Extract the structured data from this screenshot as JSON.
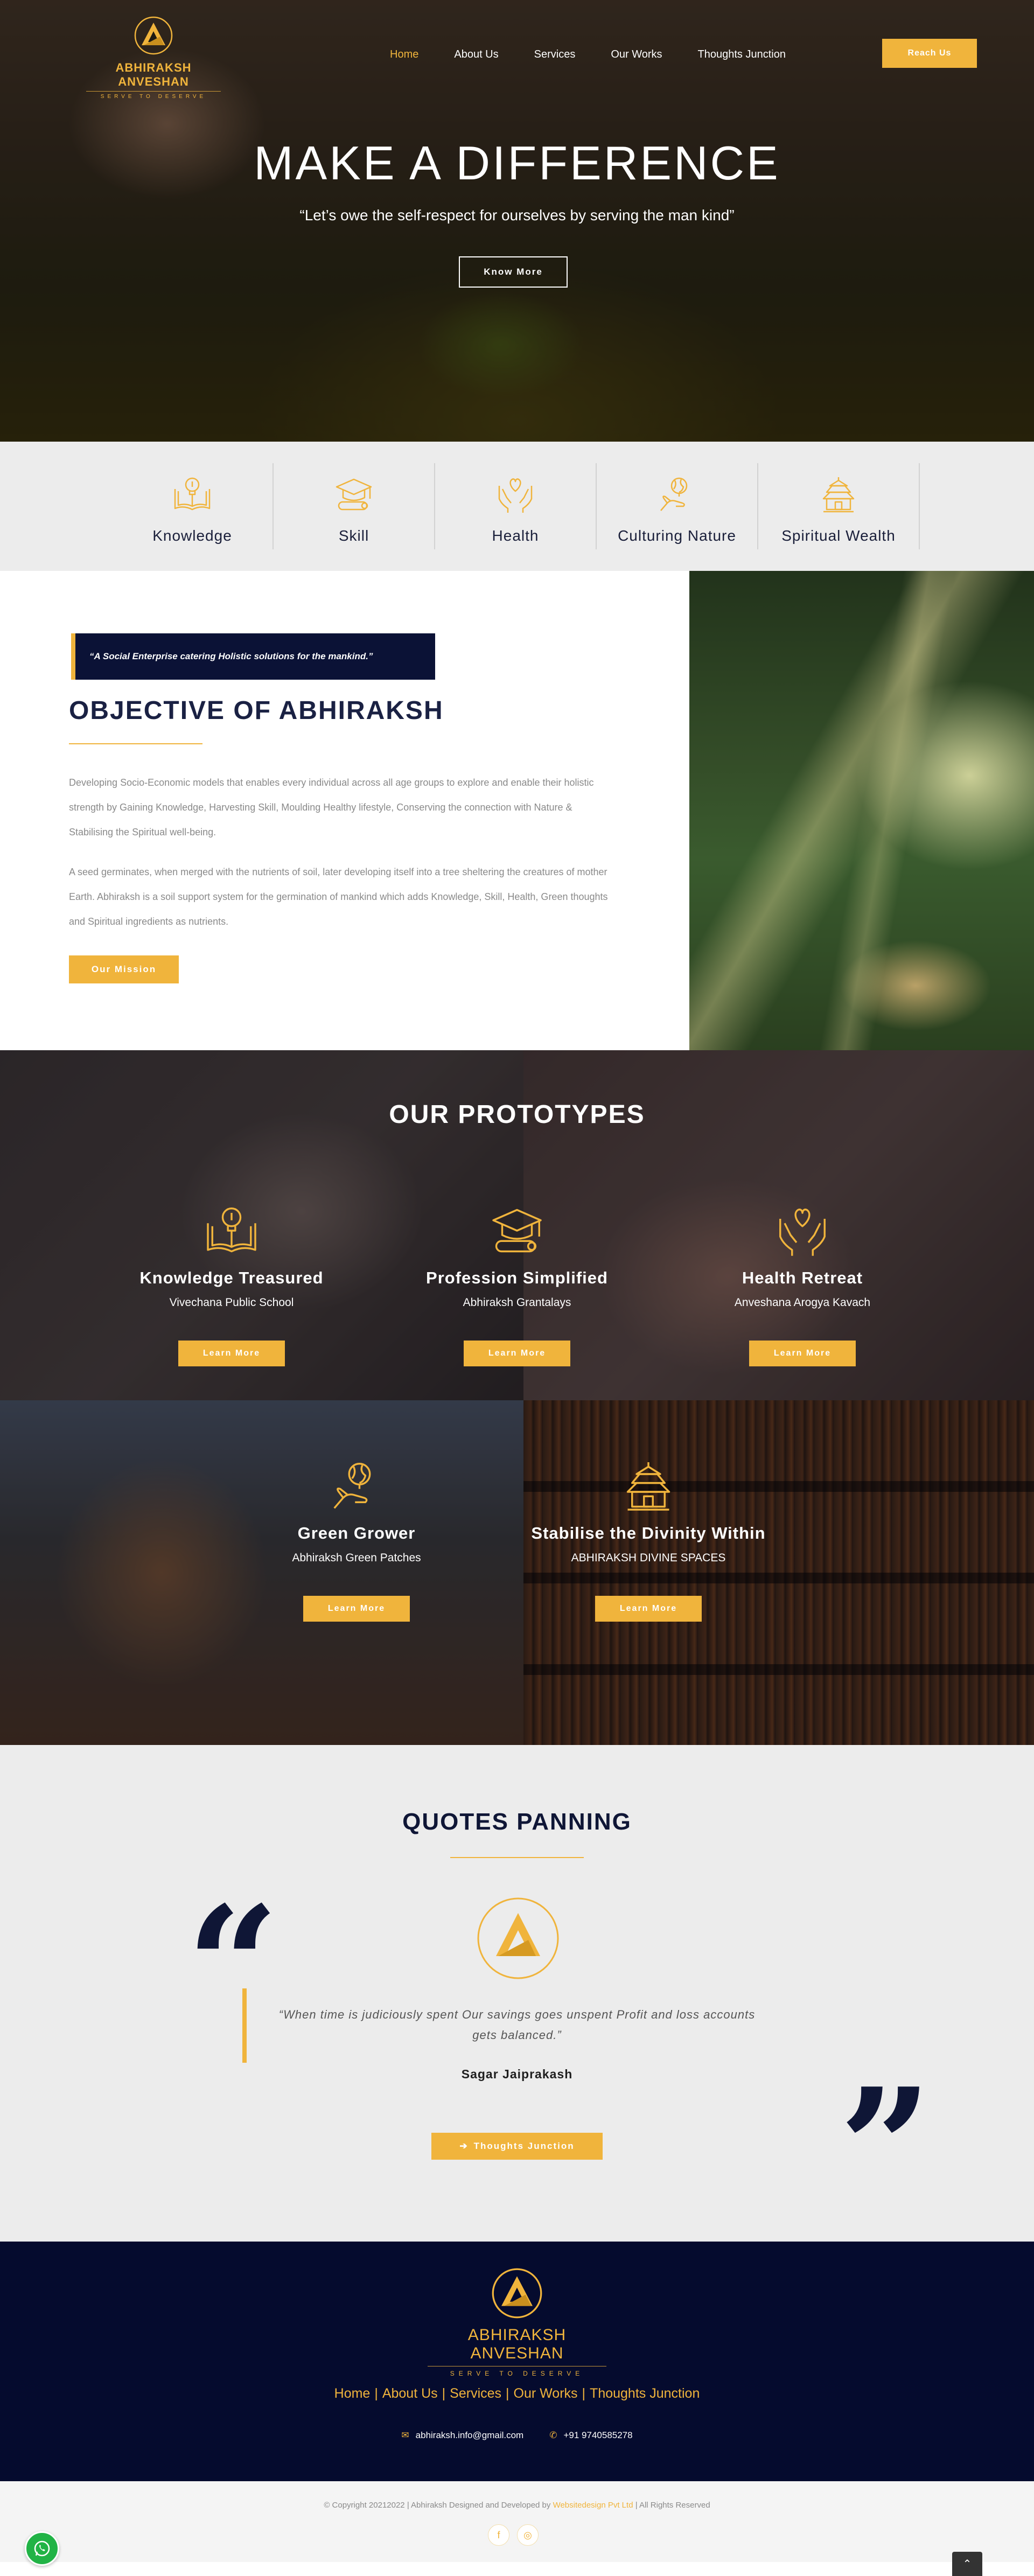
{
  "brand": {
    "name": "ABHIRAKSH ANVESHAN",
    "tagline": "SERVE TO DESERVE"
  },
  "nav": {
    "items": [
      {
        "label": "Home",
        "active": true
      },
      {
        "label": "About Us"
      },
      {
        "label": "Services"
      },
      {
        "label": "Our Works"
      },
      {
        "label": "Thoughts Junction"
      }
    ],
    "cta": "Reach Us"
  },
  "hero": {
    "title": "MAKE A DIFFERENCE",
    "subtitle": "“Let’s owe the self-respect for ourselves by serving the man kind”",
    "button": "Know More"
  },
  "features": [
    {
      "label": "Knowledge",
      "icon": "book-lightbulb-icon"
    },
    {
      "label": "Skill",
      "icon": "graduation-cap-icon"
    },
    {
      "label": "Health",
      "icon": "hands-heart-icon"
    },
    {
      "label": "Culturing Nature",
      "icon": "hand-globe-icon"
    },
    {
      "label": "Spiritual Wealth",
      "icon": "temple-icon"
    }
  ],
  "objective": {
    "quote": "“A Social Enterprise catering Holistic solutions for the mankind.”",
    "title": "OBJECTIVE OF ABHIRAKSH",
    "para1": "Developing Socio-Economic models that enables every individual across all age groups to explore and enable their holistic strength by Gaining Knowledge, Harvesting Skill, Moulding Healthy lifestyle, Conserving the connection with Nature & Stabilising the Spiritual well-being.",
    "para2": "A seed germinates, when merged with the nutrients of soil, later developing itself into a tree sheltering the creatures of mother Earth. Abhiraksh is a soil support system for the germination of mankind which adds Knowledge, Skill, Health, Green thoughts and Spiritual ingredients as nutrients.",
    "button": "Our Mission"
  },
  "prototypes": {
    "title": "OUR PROTOTYPES",
    "cards": [
      {
        "title": "Knowledge Treasured",
        "subtitle": "Vivechana Public School",
        "button": "Learn More",
        "icon": "book-lightbulb-icon"
      },
      {
        "title": "Profession Simplified",
        "subtitle": "Abhiraksh Grantalays",
        "button": "Learn More",
        "icon": "graduation-cap-icon"
      },
      {
        "title": "Health Retreat",
        "subtitle": "Anveshana Arogya Kavach",
        "button": "Learn More",
        "icon": "hands-heart-icon"
      },
      {
        "title": "Green Grower",
        "subtitle": "Abhiraksh Green Patches",
        "button": "Learn More",
        "icon": "hand-globe-icon"
      },
      {
        "title": "Stabilise the Divinity Within",
        "subtitle": "ABHIRAKSH DIVINE SPACES",
        "button": "Learn More",
        "icon": "temple-icon"
      }
    ]
  },
  "quotes": {
    "title": "QUOTES PANNING",
    "text": "“When time is judiciously spent Our savings goes unspent Profit and loss accounts gets balanced.”",
    "author": "Sagar Jaiprakash",
    "button": "Thoughts Junction",
    "open_mark": "“",
    "close_mark": "”"
  },
  "footer": {
    "links": [
      "Home",
      "About Us",
      "Services",
      "Our Works",
      "Thoughts Junction"
    ],
    "separator": "|",
    "email": "abhiraksh.info@gmail.com",
    "phone": "+91 9740585278",
    "copyright_prefix": "© Copyright 20212022 | Abhiraksh Designed and Developed by ",
    "developer": "Websitedesign Pvt Ltd",
    "copyright_suffix": " | All Rights Reserved"
  },
  "colors": {
    "accent": "#f0b43c",
    "navy": "#050b2e",
    "dark_text": "#1a2143"
  }
}
